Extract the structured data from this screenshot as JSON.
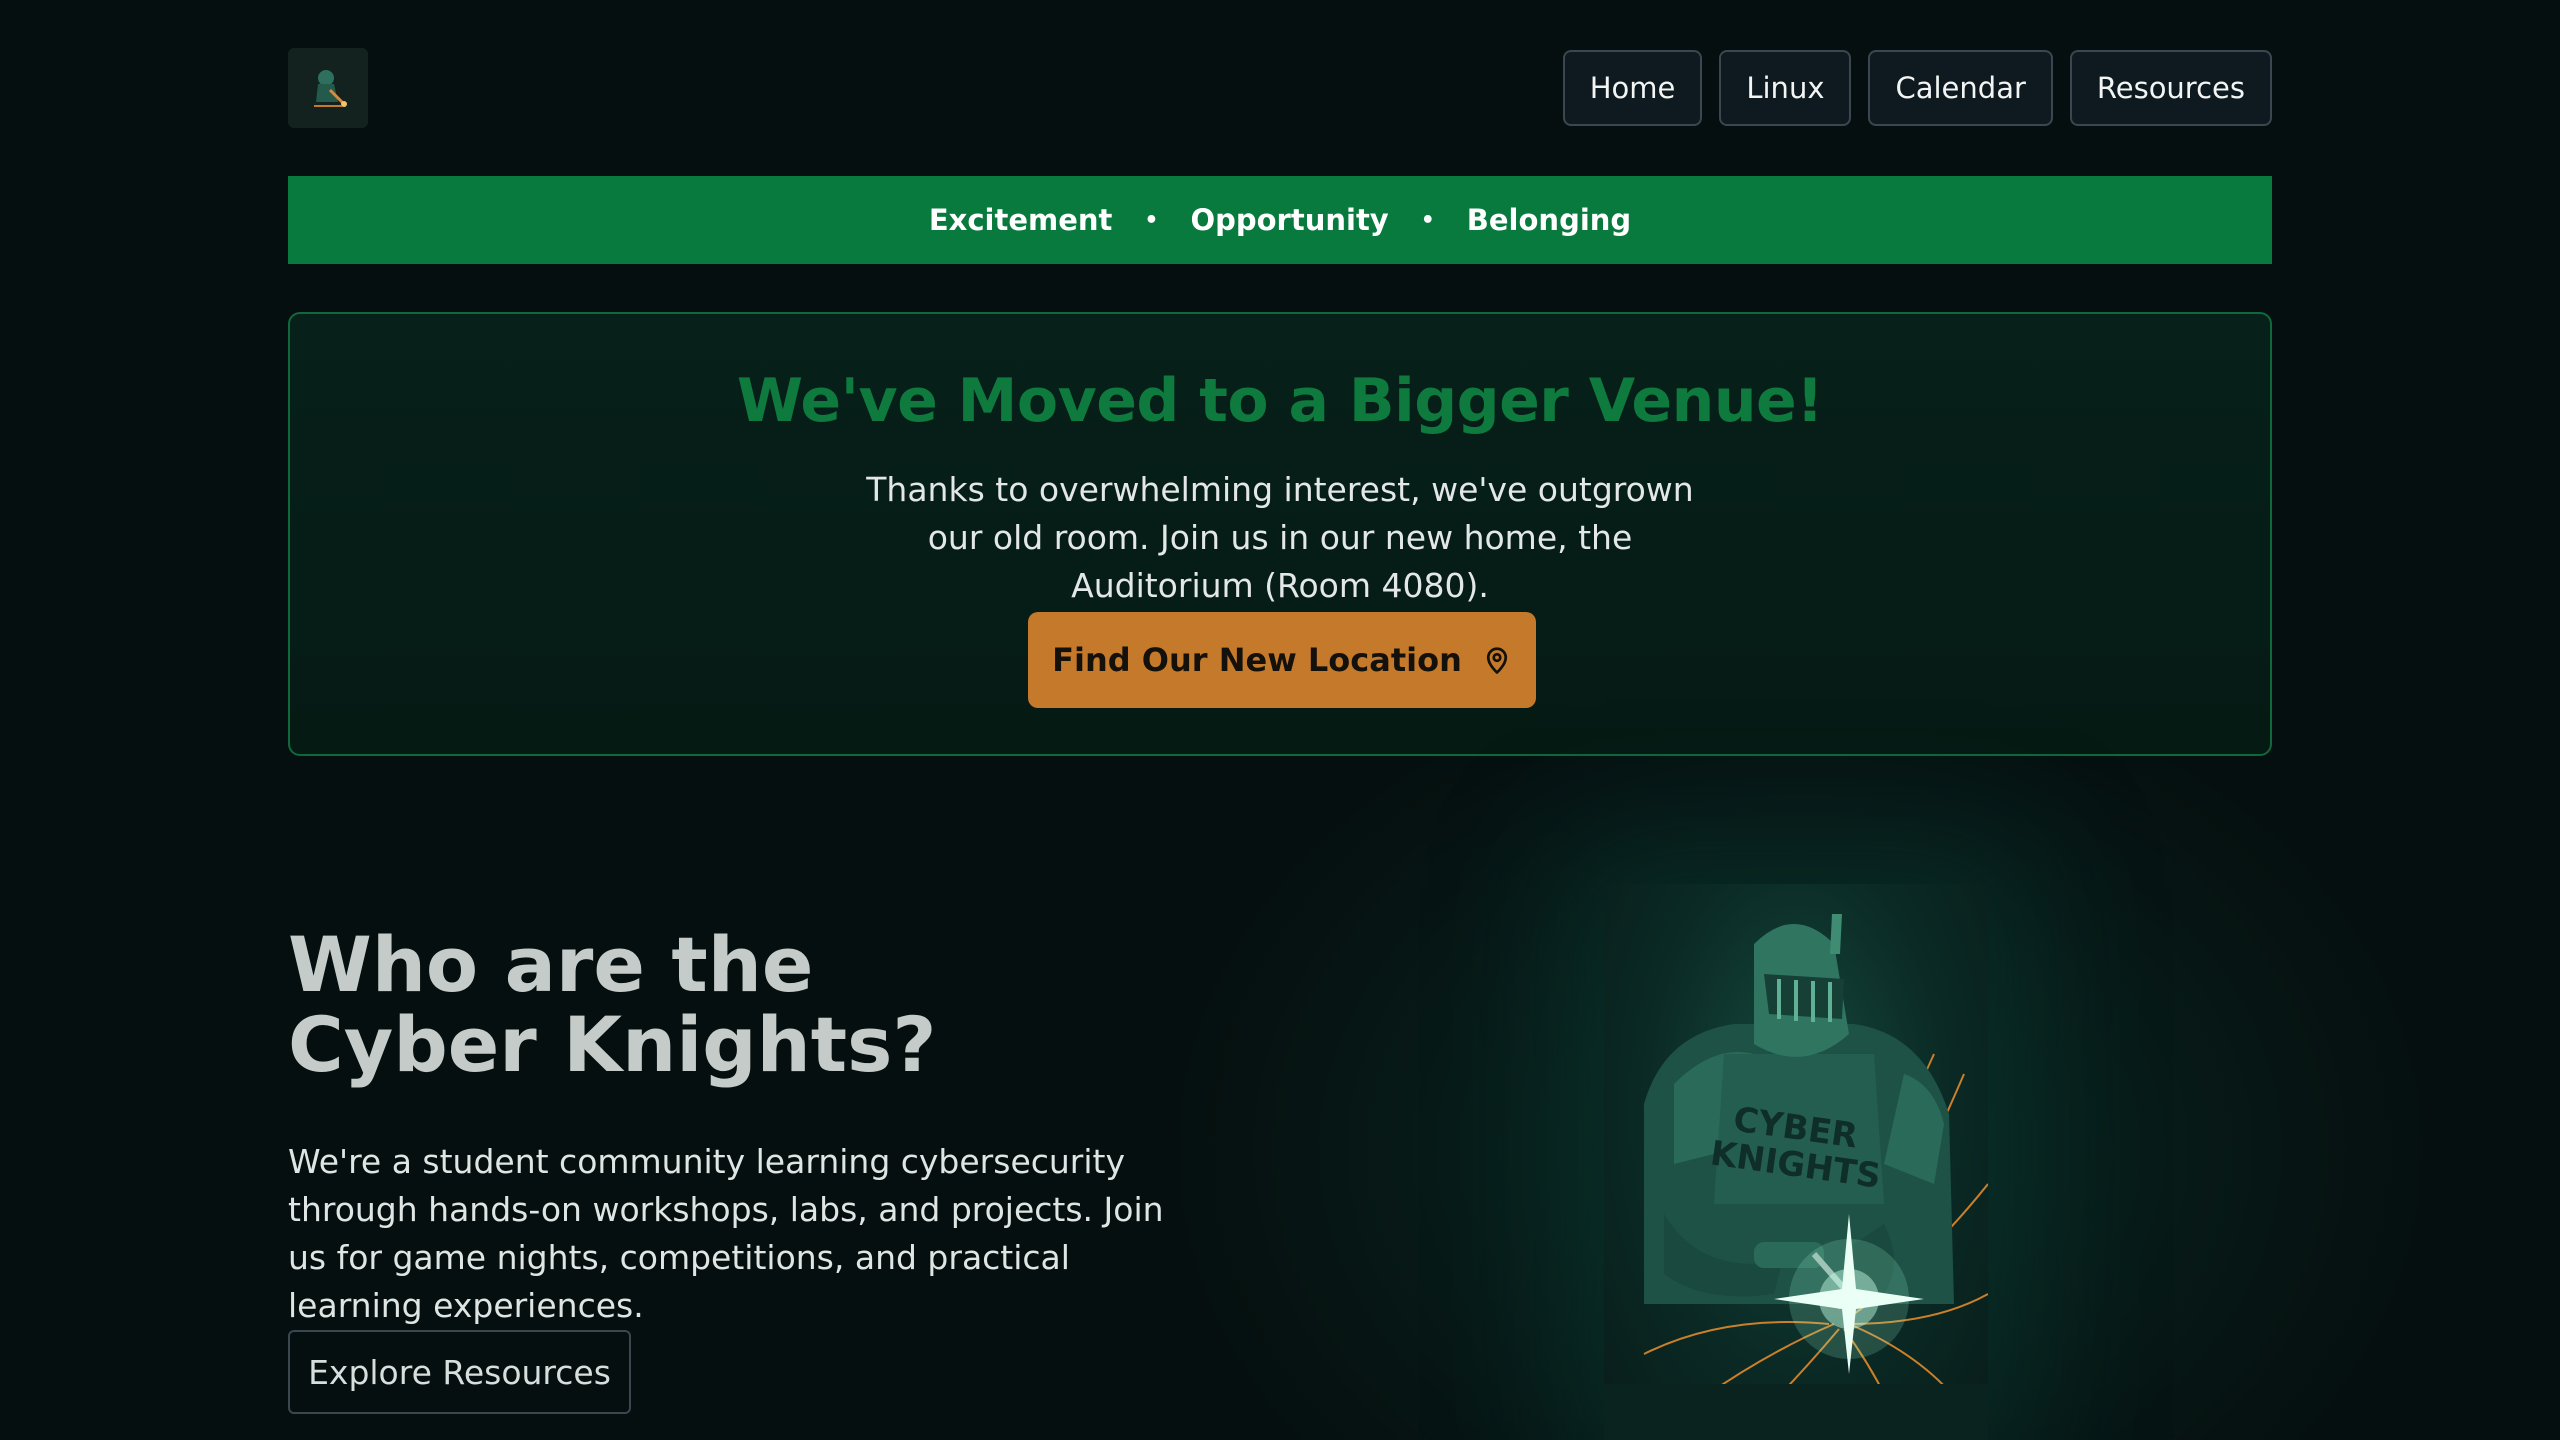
{
  "header": {
    "logo_icon": "knight-welder-logo-icon",
    "nav": [
      {
        "label": "Home"
      },
      {
        "label": "Linux"
      },
      {
        "label": "Calendar"
      },
      {
        "label": "Resources"
      }
    ]
  },
  "banner": {
    "items": [
      "Excitement",
      "Opportunity",
      "Belonging"
    ],
    "separator": "•",
    "color": "#087a3e"
  },
  "announcement": {
    "title": "We've Moved to a Bigger Venue!",
    "body": "Thanks to overwhelming interest, we've outgrown our old room. Join us in our new home, the Auditorium (Room 4080).",
    "cta_label": "Find Our New Location",
    "cta_icon": "map-pin-icon",
    "accent_color": "#0e7a3e",
    "cta_color": "#c47a2a"
  },
  "about": {
    "title": "Who are the Cyber Knights?",
    "body": "We're a student community learning cybersecurity through hands-on workshops, labs, and projects. Join us for game nights, competitions, and practical learning experiences.",
    "button_label": "Explore Resources"
  },
  "hero_image": {
    "subject": "cyber-knight-welding-illustration",
    "chest_text_line1": "CYBER",
    "chest_text_line2": "KNIGHTS"
  }
}
